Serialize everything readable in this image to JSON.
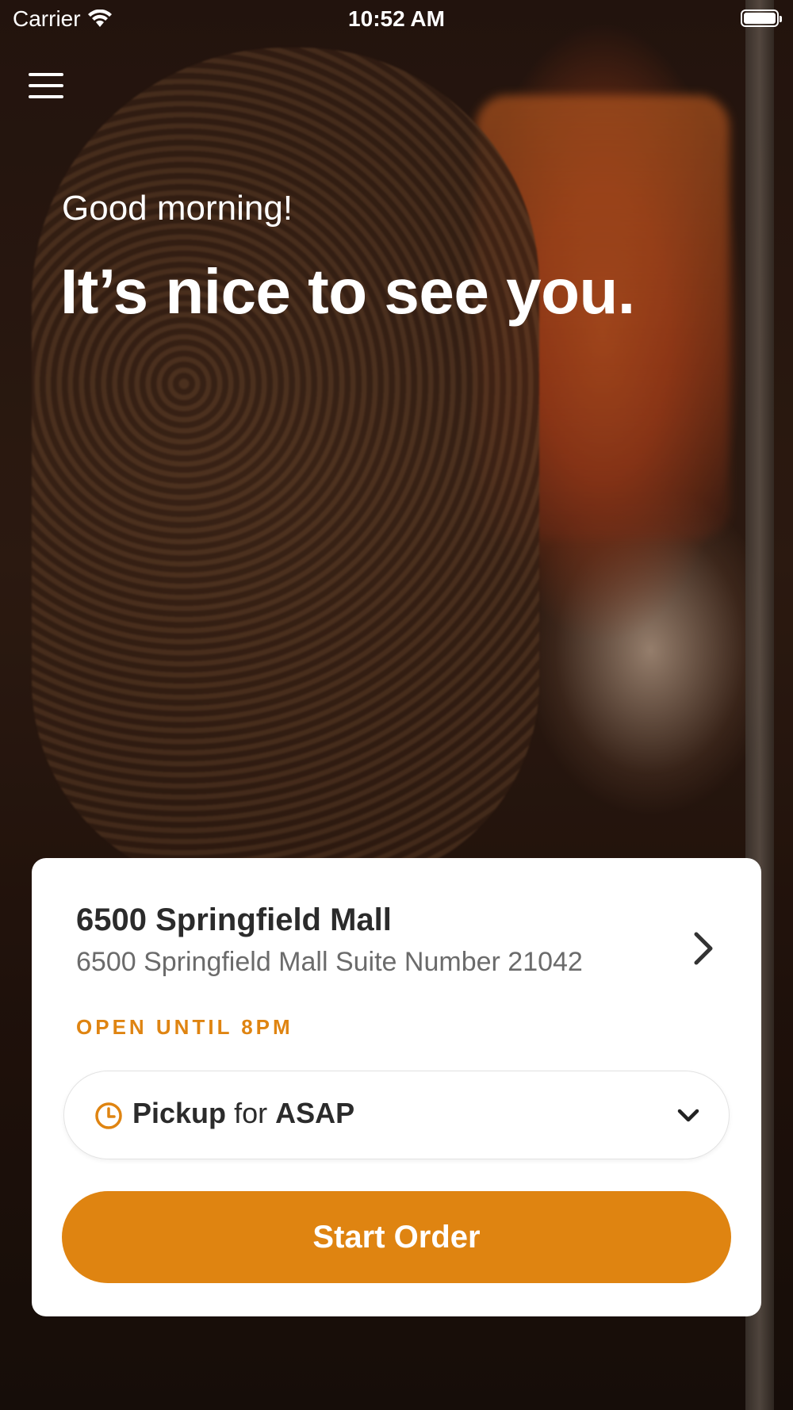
{
  "status_bar": {
    "carrier": "Carrier",
    "time": "10:52 AM"
  },
  "header": {
    "menu_icon": "hamburger-menu-icon"
  },
  "greeting": {
    "salutation": "Good morning!",
    "headline": "It’s nice to see you."
  },
  "location": {
    "name": "6500 Springfield Mall",
    "address": "6500 Springfield Mall Suite Number 21042",
    "hours": "OPEN UNTIL 8PM"
  },
  "pickup": {
    "mode": "Pickup",
    "connector": "for",
    "time": "ASAP"
  },
  "cta": {
    "label": "Start Order"
  },
  "colors": {
    "accent": "#DF8411",
    "text_dark": "#2B2B2B",
    "text_muted": "#6B6B6B"
  }
}
